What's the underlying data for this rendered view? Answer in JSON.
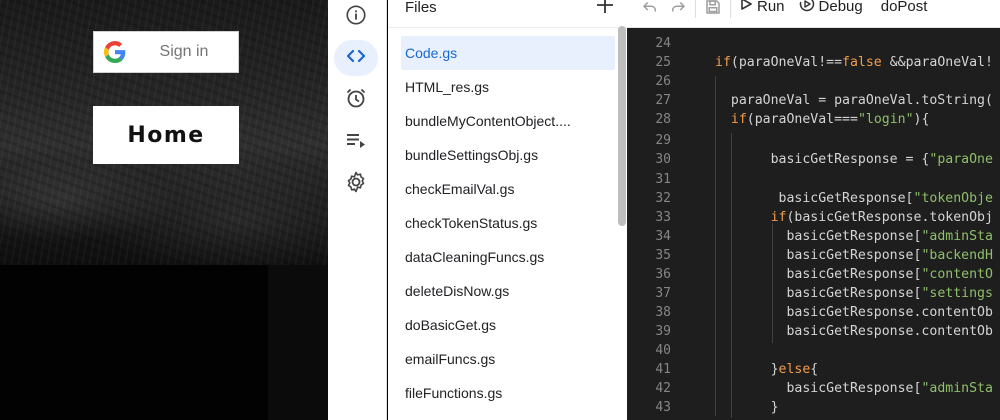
{
  "left_panel": {
    "signin_label": "Sign in",
    "home_label": "Home"
  },
  "rail": {
    "icons": [
      "info-icon",
      "code-icon",
      "alarm-clock-icon",
      "playlist-icon",
      "settings-gear-icon"
    ],
    "active": "code-icon"
  },
  "files_panel": {
    "title": "Files",
    "add_icon": "plus-icon",
    "items": [
      "Code.gs",
      "HTML_res.gs",
      "bundleMyContentObject....",
      "bundleSettingsObj.gs",
      "checkEmailVal.gs",
      "checkTokenStatus.gs",
      "dataCleaningFuncs.gs",
      "deleteDisNow.gs",
      "doBasicGet.gs",
      "emailFuncs.gs",
      "fileFunctions.gs"
    ],
    "active_index": 0
  },
  "toolbar": {
    "undo_icon": "undo-icon",
    "redo_icon": "redo-icon",
    "save_icon": "save-icon",
    "run_label": "Run",
    "debug_label": "Debug",
    "function_label": "doPost"
  },
  "editor": {
    "lines": [
      {
        "n": "24",
        "code": ""
      },
      {
        "n": "25",
        "code": "if(paraOneVal!==false &&paraOneVal!"
      },
      {
        "n": "26",
        "code": ""
      },
      {
        "n": "27",
        "code": "  paraOneVal = paraOneVal.toString("
      },
      {
        "n": "28",
        "code": "  if(paraOneVal===\"login\"){"
      },
      {
        "n": "29",
        "code": ""
      },
      {
        "n": "30",
        "code": "       basicGetResponse = {\"paraOne"
      },
      {
        "n": "31",
        "code": ""
      },
      {
        "n": "32",
        "code": "        basicGetResponse[\"tokenObje"
      },
      {
        "n": "33",
        "code": "       if(basicGetResponse.tokenObj"
      },
      {
        "n": "34",
        "code": "         basicGetResponse[\"adminSta"
      },
      {
        "n": "35",
        "code": "         basicGetResponse[\"backendH"
      },
      {
        "n": "36",
        "code": "         basicGetResponse[\"contentO"
      },
      {
        "n": "37",
        "code": "         basicGetResponse[\"settings"
      },
      {
        "n": "38",
        "code": "         basicGetResponse.contentOb"
      },
      {
        "n": "39",
        "code": "         basicGetResponse.contentOb"
      },
      {
        "n": "40",
        "code": ""
      },
      {
        "n": "41",
        "code": "       }else{"
      },
      {
        "n": "42",
        "code": "         basicGetResponse[\"adminSta"
      },
      {
        "n": "43",
        "code": "       }"
      }
    ]
  },
  "colors": {
    "accent": "#1967d2",
    "active_bg": "#e8f0fe",
    "editor_bg": "#1e1e1e",
    "keyword": "#f29b49",
    "string": "#8fbf6a"
  }
}
